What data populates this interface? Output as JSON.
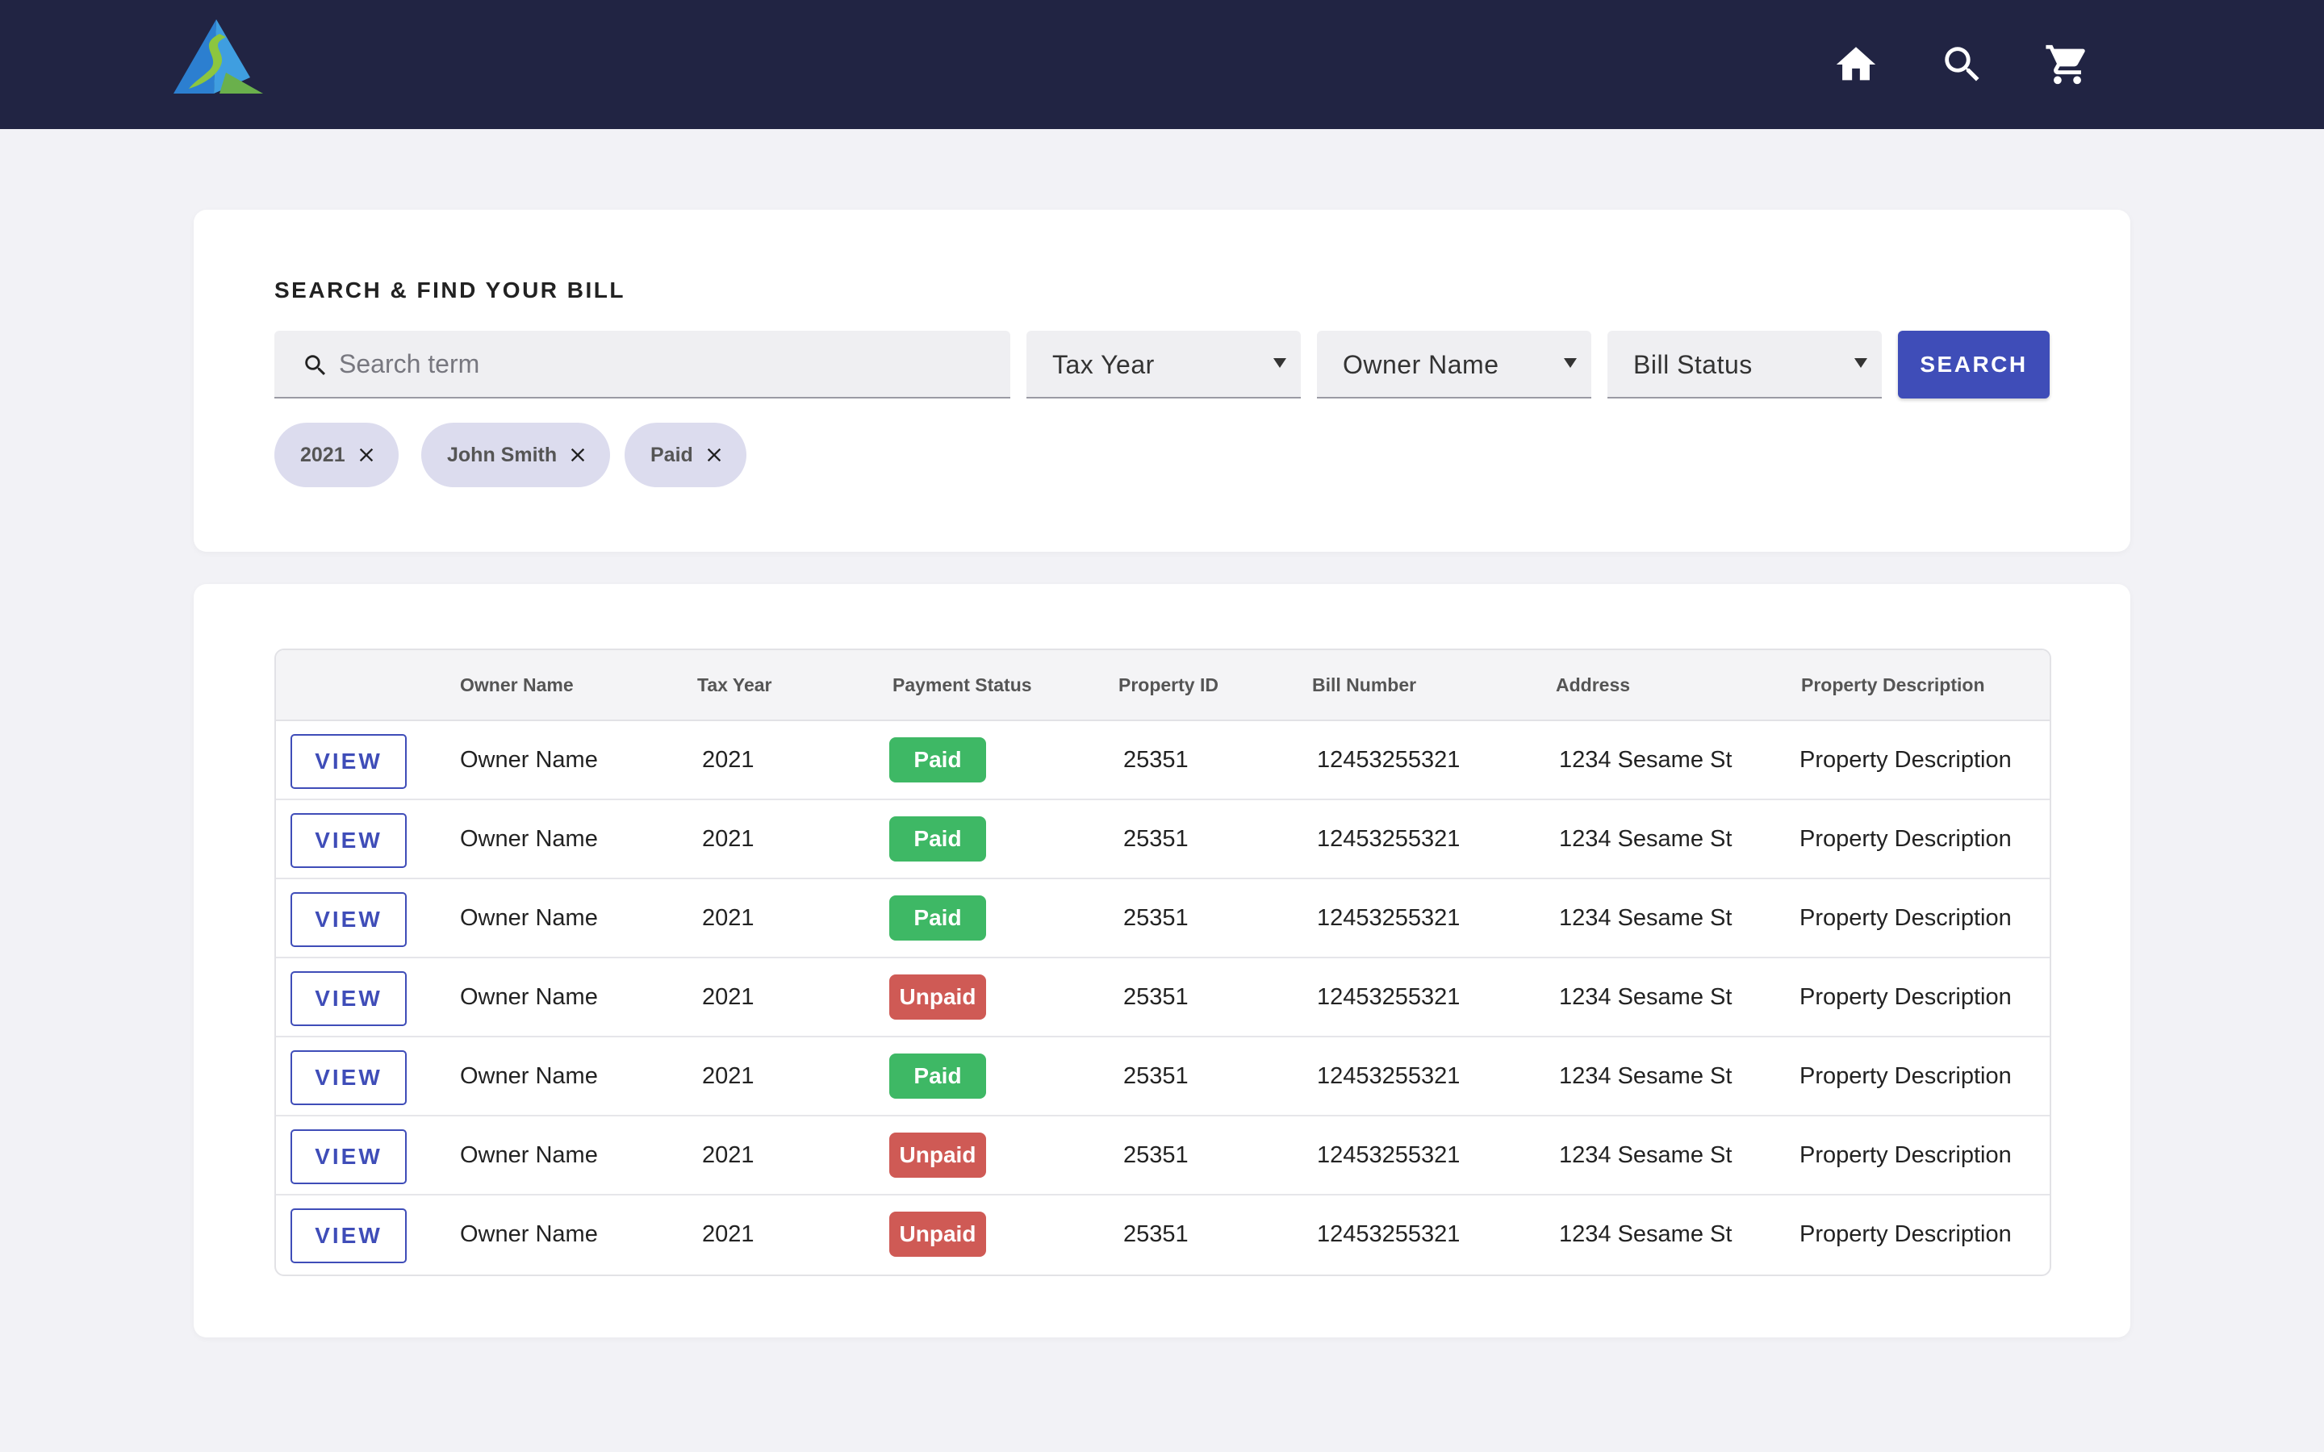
{
  "header": {
    "logo_alt": "logo",
    "icons": [
      "home-icon",
      "search-icon",
      "cart-icon"
    ]
  },
  "search": {
    "title": "SEARCH & FIND YOUR BILL",
    "placeholder": "Search term",
    "value": "",
    "tax_year_label": "Tax Year",
    "owner_name_label": "Owner Name",
    "bill_status_label": "Bill Status",
    "button_label": "SEARCH"
  },
  "chips": [
    {
      "label": "2021"
    },
    {
      "label": "John Smith"
    },
    {
      "label": "Paid"
    }
  ],
  "table": {
    "view_label": "VIEW",
    "headers": [
      "",
      "Owner Name",
      "Tax Year",
      "Payment Status",
      "Property ID",
      "Bill Number",
      "Address",
      "Property Description"
    ],
    "rows": [
      {
        "owner": "Owner Name",
        "year": "2021",
        "status": "Paid",
        "property_id": "25351",
        "bill_number": "12453255321",
        "address": "1234 Sesame St",
        "description": "Property Description"
      },
      {
        "owner": "Owner Name",
        "year": "2021",
        "status": "Paid",
        "property_id": "25351",
        "bill_number": "12453255321",
        "address": "1234 Sesame St",
        "description": "Property Description"
      },
      {
        "owner": "Owner Name",
        "year": "2021",
        "status": "Paid",
        "property_id": "25351",
        "bill_number": "12453255321",
        "address": "1234 Sesame St",
        "description": "Property Description"
      },
      {
        "owner": "Owner Name",
        "year": "2021",
        "status": "Unpaid",
        "property_id": "25351",
        "bill_number": "12453255321",
        "address": "1234 Sesame St",
        "description": "Property Description"
      },
      {
        "owner": "Owner Name",
        "year": "2021",
        "status": "Paid",
        "property_id": "25351",
        "bill_number": "12453255321",
        "address": "1234 Sesame St",
        "description": "Property Description"
      },
      {
        "owner": "Owner Name",
        "year": "2021",
        "status": "Unpaid",
        "property_id": "25351",
        "bill_number": "12453255321",
        "address": "1234 Sesame St",
        "description": "Property Description"
      },
      {
        "owner": "Owner Name",
        "year": "2021",
        "status": "Unpaid",
        "property_id": "25351",
        "bill_number": "12453255321",
        "address": "1234 Sesame St",
        "description": "Property Description"
      }
    ]
  },
  "colors": {
    "header_bg": "#212443",
    "accent": "#3f4db8",
    "paid": "#3eb865",
    "unpaid": "#cf5a55",
    "chip_bg": "#dcdcee",
    "page_bg": "#f2f2f6"
  }
}
